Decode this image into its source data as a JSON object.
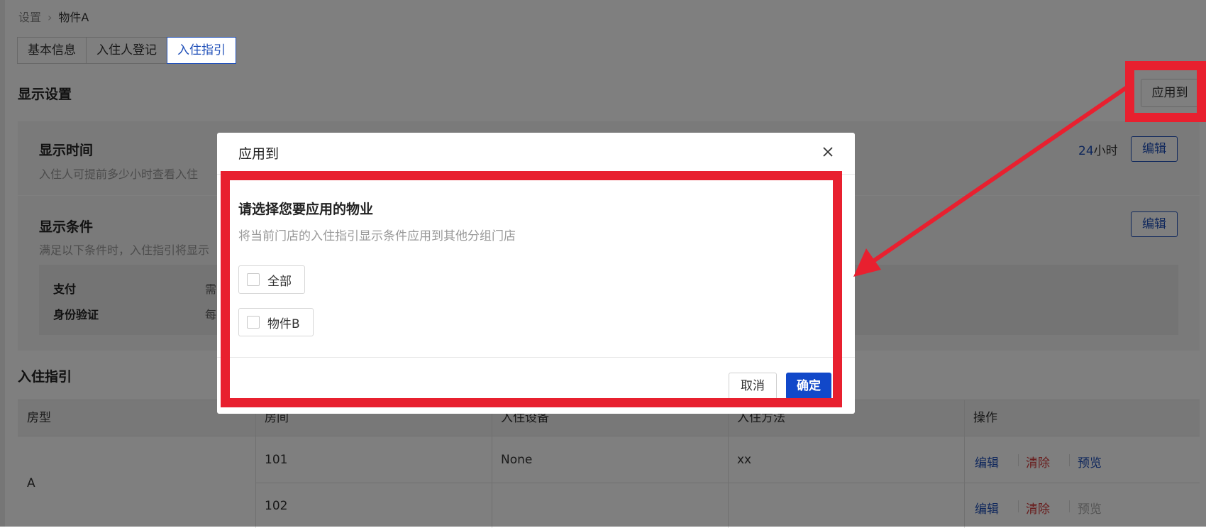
{
  "breadcrumb": {
    "root": "设置",
    "current": "物件A"
  },
  "tabs": [
    {
      "label": "基本信息"
    },
    {
      "label": "入住人登记"
    },
    {
      "label": "入住指引"
    }
  ],
  "display_settings": {
    "title": "显示设置",
    "apply_button": "应用到",
    "display_time": {
      "title": "显示时间",
      "desc": "入住人可提前多少小时查看入住",
      "value_num": "24",
      "value_unit": "小时",
      "edit": "编辑"
    },
    "display_condition": {
      "title": "显示条件",
      "desc": "满足以下条件时，入住指引将显示",
      "edit": "编辑",
      "rows": [
        {
          "label": "支付",
          "value": "需"
        },
        {
          "label": "身份验证",
          "value": "每"
        }
      ]
    }
  },
  "guide": {
    "title": "入住指引",
    "columns": [
      "房型",
      "房间",
      "入住设备",
      "入住方法",
      "操作"
    ],
    "room_type": "A",
    "rows": [
      {
        "room": "101",
        "device": "None",
        "method": "xx",
        "actions": [
          "编辑",
          "清除",
          "预览"
        ]
      },
      {
        "room": "102",
        "device": "",
        "method": "",
        "actions": [
          "编辑",
          "清除",
          "预览"
        ]
      }
    ]
  },
  "modal": {
    "title": "应用到",
    "close_icon": "close-icon",
    "heading": "请选择您要应用的物业",
    "desc": "将当前门店的入住指引显示条件应用到其他分组门店",
    "options": [
      {
        "label": "全部",
        "checked": false
      },
      {
        "label": "物件B",
        "checked": false
      }
    ],
    "cancel": "取消",
    "ok": "确定"
  },
  "colors": {
    "accent": "#1f4fb8",
    "primary_button": "#1148c9",
    "danger": "#d23c3c",
    "annotation": "#e8202f"
  }
}
